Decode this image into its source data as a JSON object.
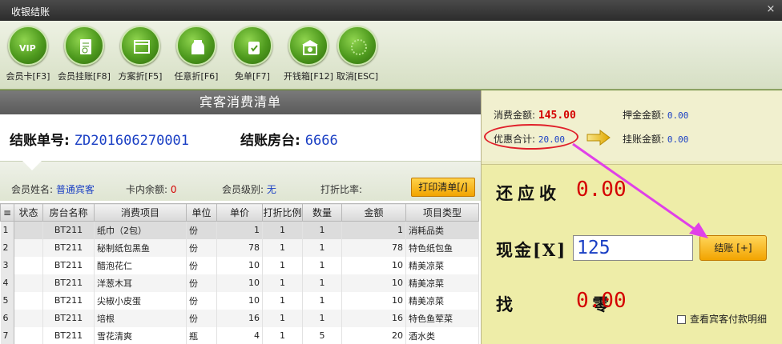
{
  "window": {
    "title": "收银结账",
    "close": "×"
  },
  "toolbar": [
    {
      "label": "会员卡[F3]",
      "icon": "vip-icon"
    },
    {
      "label": "会员挂账[F8]",
      "icon": "document-icon"
    },
    {
      "label": "方案折[F5]",
      "icon": "window-icon"
    },
    {
      "label": "任意折[F6]",
      "icon": "jar-icon"
    },
    {
      "label": "免单[F7]",
      "icon": "bag-icon"
    },
    {
      "label": "开钱箱[F12]",
      "icon": "cashbox-icon"
    },
    {
      "label": "取消[ESC]",
      "icon": "cancel-icon"
    }
  ],
  "left": {
    "banner": "宾客消费清单",
    "bill_no_label": "结账单号:",
    "bill_no": "ZD201606270001",
    "room_label": "结账房台:",
    "room": "6666",
    "member_name_label": "会员姓名:",
    "member_name": "普通宾客",
    "card_balance_label": "卡内余额:",
    "card_balance": "0",
    "member_level_label": "会员级别:",
    "member_level": "无",
    "discount_label": "打折比率:",
    "discount": "",
    "print_button": "打印清单[/]"
  },
  "table": {
    "headers": [
      "状态",
      "房台名称",
      "消费项目",
      "单位",
      "单价",
      "打折比例",
      "数量",
      "金额",
      "项目类型"
    ],
    "rows": [
      [
        "",
        "BT211",
        "纸巾（2包）",
        "份",
        "1",
        "1",
        "1",
        "1",
        "消耗品类"
      ],
      [
        "",
        "BT211",
        "秘制纸包黑鱼",
        "份",
        "78",
        "1",
        "1",
        "78",
        "特色纸包鱼"
      ],
      [
        "",
        "BT211",
        "醋泡花仁",
        "份",
        "10",
        "1",
        "1",
        "10",
        "精美凉菜"
      ],
      [
        "",
        "BT211",
        "洋葱木耳",
        "份",
        "10",
        "1",
        "1",
        "10",
        "精美凉菜"
      ],
      [
        "",
        "BT211",
        "尖椒小皮蛋",
        "份",
        "10",
        "1",
        "1",
        "10",
        "精美凉菜"
      ],
      [
        "",
        "BT211",
        "培根",
        "份",
        "16",
        "1",
        "1",
        "16",
        "特色鱼荤菜"
      ],
      [
        "",
        "BT211",
        "雪花清爽",
        "瓶",
        "4",
        "1",
        "5",
        "20",
        "酒水类"
      ]
    ]
  },
  "summary": {
    "consume_label": "消费金额:",
    "consume": "145.00",
    "deposit_label": "押金金额:",
    "deposit": "0.00",
    "discount_total_label": "优惠合计:",
    "discount_total": "20.00",
    "credit_label": "挂账金额:",
    "credit": "0.00"
  },
  "payment": {
    "due_label": "还应收",
    "due": "0.00",
    "cash_label": "现金[X]",
    "cash_value": "125",
    "settle_button": "结账 [+]",
    "change_label": "找 零",
    "change": "0.00",
    "view_detail_label": "查看宾客付款明细"
  },
  "colors": {
    "accent_red": "#d40000",
    "value_blue": "#1a3fc4",
    "button_orange": "#f2a400",
    "annotation_magenta": "#e040e8",
    "annotation_red": "#e0202a"
  }
}
